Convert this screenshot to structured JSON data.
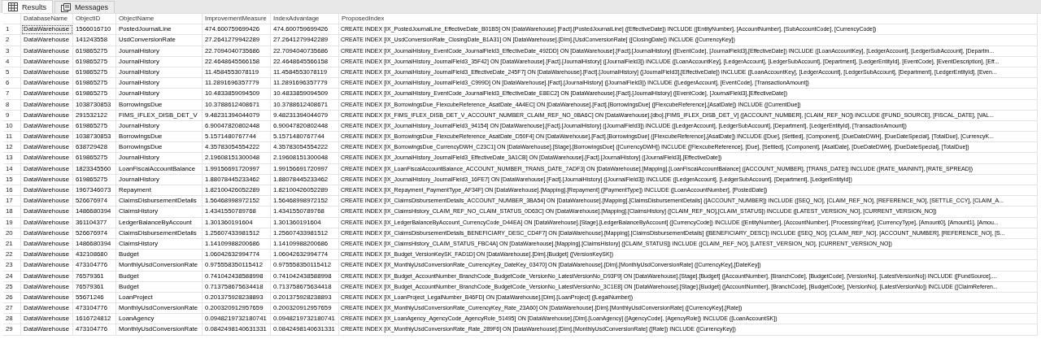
{
  "tabs": [
    {
      "label": "Results",
      "kind": "grid",
      "selected": true
    },
    {
      "label": "Messages",
      "kind": "messages",
      "selected": false
    }
  ],
  "grid": {
    "columns": [
      "DatabaseName",
      "ObjectID",
      "ObjectName",
      "ImprovementMeasure",
      "IndexAdvantage",
      "ProposedIndex"
    ],
    "rows": [
      {
        "number": "1",
        "focused": true,
        "cells": [
          "DataWarehouse",
          "1566016710",
          "PostedJournalLine",
          "474.600759699426",
          "474.600759699426",
          "CREATE INDEX [IX_PostedJournalLine_EffectiveDate_B01B5] ON [DataWarehouse].[Fact].[PostedJournalLine] ([EffectiveDate]) INCLUDE ([EntityNumber], [AccountNumber], [SubAccountCode], [CurrencyCode])"
        ]
      },
      {
        "number": "2",
        "focused": false,
        "cells": [
          "DataWarehouse",
          "141243558",
          "UsdConversionRate",
          "27.2641279942289",
          "27.2641279942289",
          "CREATE INDEX [IX_UsdConversionRate_ClosingDate_B1A31] ON [DataWarehouse].[Dim].[UsdConversionRate] ([ClosingDate]) INCLUDE ([CurrencyKey])"
        ]
      },
      {
        "number": "3",
        "focused": false,
        "cells": [
          "DataWarehouse",
          "619865275",
          "JournalHistory",
          "22.7094040735686",
          "22.7094040735686",
          "CREATE INDEX [IX_JournalHistory_EventCode_JournalField3_EffectiveDate_492DD] ON [DataWarehouse].[Fact].[JournalHistory] ([EventCode], [JournalField3],[EffectiveDate]) INCLUDE ([LoanAccountKey], [LedgerAccount], [LedgerSubAccount], [Departm..."
        ]
      },
      {
        "number": "4",
        "focused": false,
        "cells": [
          "DataWarehouse",
          "619865275",
          "JournalHistory",
          "22.4648645566158",
          "22.4648645566158",
          "CREATE INDEX [IX_JournalHistory_JournalField3_35F42] ON [DataWarehouse].[Fact].[JournalHistory] ([JournalField3]) INCLUDE ([LoanAccountKey], [LedgerAccount], [LedgerSubAccount], [Department], [LedgerEntityId], [EventCode], [EventDescription], [Eff..."
        ]
      },
      {
        "number": "5",
        "focused": false,
        "cells": [
          "DataWarehouse",
          "619865275",
          "JournalHistory",
          "11.4584553078119",
          "11.4584553078119",
          "CREATE INDEX [IX_JournalHistory_JournalField3_EffectiveDate_245F7] ON [DataWarehouse].[Fact].[JournalHistory] ([JournalField3],[EffectiveDate]) INCLUDE ([LoanAccountKey], [LedgerAccount], [LedgerSubAccount], [Department], [LedgerEntityId], [Even..."
        ]
      },
      {
        "number": "6",
        "focused": false,
        "cells": [
          "DataWarehouse",
          "619865275",
          "JournalHistory",
          "11.2891696357779",
          "11.2891696357779",
          "CREATE INDEX [IX_JournalHistory_JournalField3_C999D] ON [DataWarehouse].[Fact].[JournalHistory] ([JournalField3]) INCLUDE ([LedgerAccount], [EventCode], [TransactionAmount])"
        ]
      },
      {
        "number": "7",
        "focused": false,
        "cells": [
          "DataWarehouse",
          "619865275",
          "JournalHistory",
          "10.4833859094509",
          "10.4833859094509",
          "CREATE INDEX [IX_JournalHistory_EventCode_JournalField3_EffectiveDate_E8EC2] ON [DataWarehouse].[Fact].[JournalHistory] ([EventCode], [JournalField3],[EffectiveDate])"
        ]
      },
      {
        "number": "8",
        "focused": false,
        "cells": [
          "DataWarehouse",
          "1038730853",
          "BorrowingsDue",
          "10.3788612408671",
          "10.3788612408671",
          "CREATE INDEX [IX_BorrowingsDue_FlexcubeReference_AsatDate_4A4EC] ON [DataWarehouse].[Fact].[BorrowingsDue] ([FlexcubeReference],[AsatDate]) INCLUDE ([CurrentDue])"
        ]
      },
      {
        "number": "9",
        "focused": false,
        "cells": [
          "DataWarehouse",
          "291532122",
          "FIMS_IFLEX_DISB_DET_V",
          "9.48231394044079",
          "9.48231394044079",
          "CREATE INDEX [IX_FIMS_IFLEX_DISB_DET_V_ACCOUNT_NUMBER_CLAIM_REF_NO_0BA6C] ON [DataWarehouse].[dbo].[FIMS_IFLEX_DISB_DET_V] ([ACCOUNT_NUMBER], [CLAIM_REF_NO]) INCLUDE ([FUND_SOURCE], [FISCAL_DATE], [VAL..."
        ]
      },
      {
        "number": "10",
        "focused": false,
        "cells": [
          "DataWarehouse",
          "619865275",
          "JournalHistory",
          "6.90047820802448",
          "6.90047820802448",
          "CREATE INDEX [IX_JournalHistory_JournalField3_94154] ON [DataWarehouse].[Fact].[JournalHistory] ([JournalField3]) INCLUDE ([LedgerAccount], [LedgerSubAccount], [Department], [LedgerEntityId], [TransactionAmount])"
        ]
      },
      {
        "number": "11",
        "focused": false,
        "cells": [
          "DataWarehouse",
          "1038730853",
          "BorrowingsDue",
          "5.1571480767744",
          "5.1571480767744",
          "CREATE INDEX [IX_BorrowingsDue_FlexcubeReference_AsatDate_D50F4] ON [DataWarehouse].[Fact].[BorrowingsDue] ([FlexcubeReference],[AsatDate]) INCLUDE ([Due], [Settled], [Component], [DueDateDWH], [DueDateSpecial], [TotalDue], [CurrencyK..."
        ]
      },
      {
        "number": "12",
        "focused": false,
        "cells": [
          "DataWarehouse",
          "638729428",
          "BorrowingsDue",
          "4.35783054554222",
          "4.35783054554222",
          "CREATE INDEX [IX_BorrowingsDue_CurrencyDWH_C23C1] ON [DataWarehouse].[Stage].[BorrowingsDue] ([CurrencyDWH]) INCLUDE ([FlexcubeReference], [Due], [Settled], [Component], [AsatDate], [DueDateDWH], [DueDateSpecial], [TotalDue])"
        ]
      },
      {
        "number": "13",
        "focused": false,
        "cells": [
          "DataWarehouse",
          "619865275",
          "JournalHistory",
          "2.19608151300048",
          "2.19608151300048",
          "CREATE INDEX [IX_JournalHistory_JournalField3_EffectiveDate_3A1CB] ON [DataWarehouse].[Fact].[JournalHistory] ([JournalField3],[EffectiveDate])"
        ]
      },
      {
        "number": "14",
        "focused": false,
        "cells": [
          "DataWarehouse",
          "1823345560",
          "LoanFiscalAccountBalance",
          "1.99156691720997",
          "1.99156691720997",
          "CREATE INDEX [IX_LoanFiscalAccountBalance_ACCOUNT_NUMBER_TRANS_DATE_7ADF3] ON [DataWarehouse].[Mapping].[LoanFiscalAccountBalance] ([ACCOUNT_NUMBER], [TRANS_DATE]) INCLUDE ([RATE_MAININT], [RATE_SPREAD])"
        ]
      },
      {
        "number": "15",
        "focused": false,
        "cells": [
          "DataWarehouse",
          "619865275",
          "JournalHistory",
          "1.88078445233462",
          "1.88078445233462",
          "CREATE INDEX [IX_JournalHistory_JournalField3_16FE7] ON [DataWarehouse].[Fact].[JournalHistory] ([JournalField3]) INCLUDE ([LedgerAccount], [LedgerSubAccount], [Department], [LedgerEntityId])"
        ]
      },
      {
        "number": "16",
        "focused": false,
        "cells": [
          "DataWarehouse",
          "1967346073",
          "Repayment",
          "1.82100426052289",
          "1.82100426052289",
          "CREATE INDEX [IX_Repayment_PaymentType_AF34F] ON [DataWarehouse].[Mapping].[Repayment] ([PaymentType]) INCLUDE ([LoanAccountNumber], [PostedDate])"
        ]
      },
      {
        "number": "17",
        "focused": false,
        "cells": [
          "DataWarehouse",
          "526676974",
          "ClaimsDisbursementDetails",
          "1.56468998972152",
          "1.56468998972152",
          "CREATE INDEX [IX_ClaimsDisbursementDetails_ACCOUNT_NUMBER_3BA54] ON [DataWarehouse].[Mapping].[ClaimsDisbursementDetails] ([ACCOUNT_NUMBER]) INCLUDE ([SEQ_NO], [CLAIM_REF_NO], [REFERENCE_NO], [SETTLE_CCY], [CLAIM_A..."
        ]
      },
      {
        "number": "18",
        "focused": false,
        "cells": [
          "DataWarehouse",
          "1486680394",
          "ClaimsHistory",
          "1.4341550789768",
          "1.4341550789768",
          "CREATE INDEX [IX_ClaimsHistory_CLAIM_REF_NO_CLAIM_STATUS_0D63C] ON [DataWarehouse].[Mapping].[ClaimsHistory] ([CLAIM_REF_NO],[CLAIM_STATUS]) INCLUDE ([LATEST_VERSION_NO], [CURRENT_VERSION_NO])"
        ]
      },
      {
        "number": "19",
        "focused": false,
        "cells": [
          "DataWarehouse",
          "361104377",
          "LedgerBalanceByAccount",
          "1.301360191604",
          "1.301360191604",
          "CREATE INDEX [IX_LedgerBalanceByAccount_CurrencyCode_D44EA] ON [DataWarehouse].[Stage].[LedgerBalanceByAccount] ([CurrencyCode]) INCLUDE ([EntityNumber], [AccountNumber], [ProcessingYear], [CurrencyType], [Amount0], [Amount1], [Amou..."
        ]
      },
      {
        "number": "20",
        "focused": false,
        "cells": [
          "DataWarehouse",
          "526676974",
          "ClaimsDisbursementDetails",
          "1.25607433981512",
          "1.25607433981512",
          "CREATE INDEX [IX_ClaimsDisbursementDetails_BENEFICIARY_DESC_CD4F7] ON [DataWarehouse].[Mapping].[ClaimsDisbursementDetails] ([BENEFICIARY_DESC]) INCLUDE ([SEQ_NO], [CLAIM_REF_NO], [ACCOUNT_NUMBER], [REFERENCE_NO], [S..."
        ]
      },
      {
        "number": "21",
        "focused": false,
        "cells": [
          "DataWarehouse",
          "1486680394",
          "ClaimsHistory",
          "1.14109988200686",
          "1.14109988200686",
          "CREATE INDEX [IX_ClaimsHistory_CLAIM_STATUS_FBC4A] ON [DataWarehouse].[Mapping].[ClaimsHistory] ([CLAIM_STATUS]) INCLUDE ([CLAIM_REF_NO], [LATEST_VERSION_NO], [CURRENT_VERSION_NO])"
        ]
      },
      {
        "number": "22",
        "focused": false,
        "cells": [
          "DataWarehouse",
          "432108680",
          "Budget",
          "1.06042632994774",
          "1.06042632994774",
          "CREATE INDEX [IX_Budget_VersionKeySK_FAD1D] ON [DataWarehouse].[Dim].[Budget] ([VersionKeySK])"
        ]
      },
      {
        "number": "23",
        "focused": false,
        "cells": [
          "DataWarehouse",
          "473104776",
          "MonthlyUsdConversionRate",
          "0.975558350115412",
          "0.975558350115412",
          "CREATE INDEX [IX_MonthlyUsdConversionRate_CurrencyKey_DateKey_03470] ON [DataWarehouse].[Dim].[MonthlyUsdConversionRate] ([CurrencyKey],[DateKey])"
        ]
      },
      {
        "number": "24",
        "focused": false,
        "cells": [
          "DataWarehouse",
          "76579361",
          "Budget",
          "0.741042438588998",
          "0.741042438588998",
          "CREATE INDEX [IX_Budget_AccountNumber_BranchCode_BudgetCode_VersionNo_LatestVersionNo_D93F9] ON [DataWarehouse].[Stage].[Budget] ([AccountNumber], [BranchCode], [BudgetCode], [VersionNo], [LatestVersionNo]) INCLUDE ([FundSource],..."
        ]
      },
      {
        "number": "25",
        "focused": false,
        "cells": [
          "DataWarehouse",
          "76579361",
          "Budget",
          "0.713758675634418",
          "0.713758675634418",
          "CREATE INDEX [IX_Budget_AccountNumber_BranchCode_BudgetCode_VersionNo_LatestVersionNo_3C1E8] ON [DataWarehouse].[Stage].[Budget] ([AccountNumber], [BranchCode], [BudgetCode], [VersionNo], [LatestVersionNo]) INCLUDE ([ClaimReferen..."
        ]
      },
      {
        "number": "26",
        "focused": false,
        "cells": [
          "DataWarehouse",
          "55671246",
          "LoanProject",
          "0.201375928238893",
          "0.201375928238893",
          "CREATE INDEX [IX_LoanProject_LegalNumber_B46FD] ON [DataWarehouse].[Dim].[LoanProject] ([LegalNumber])"
        ]
      },
      {
        "number": "27",
        "focused": false,
        "cells": [
          "DataWarehouse",
          "473104776",
          "MonthlyUsdConversionRate",
          "0.200320912957659",
          "0.200320912957659",
          "CREATE INDEX [IX_MonthlyUsdConversionRate_CurrencyKey_Rate_23A60] ON [DataWarehouse].[Dim].[MonthlyUsdConversionRate] ([CurrencyKey],[Rate])"
        ]
      },
      {
        "number": "28",
        "focused": false,
        "cells": [
          "DataWarehouse",
          "1616724812",
          "LoanAgency",
          "0.0948219732180741",
          "0.0948219732180741",
          "CREATE INDEX [IX_LoanAgency_AgencyCode_AgencyRole_51495] ON [DataWarehouse].[Dim].[LoanAgency] ([AgencyCode], [AgencyRole]) INCLUDE ([LoanAccountSK])"
        ]
      },
      {
        "number": "29",
        "focused": false,
        "cells": [
          "DataWarehouse",
          "473104776",
          "MonthlyUsdConversionRate",
          "0.0842498140631331",
          "0.0842498140631331",
          "CREATE INDEX [IX_MonthlyUsdConversionRate_Rate_289F6] ON [DataWarehouse].[Dim].[MonthlyUsdConversionRate] ([Rate]) INCLUDE ([CurrencyKey])"
        ]
      }
    ]
  }
}
